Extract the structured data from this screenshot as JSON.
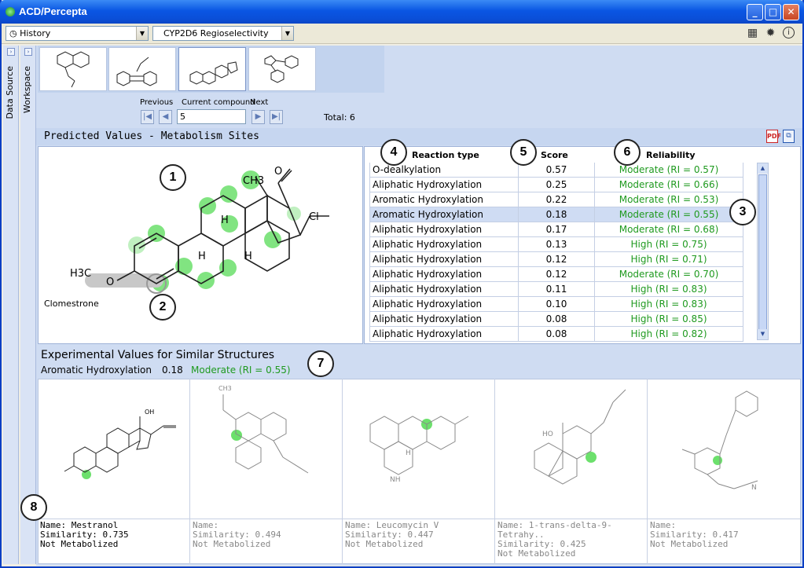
{
  "window": {
    "title": "ACD/Percepta"
  },
  "toolbar": {
    "history_label": "History",
    "module_label": "CYP2D6 Regioselectivity",
    "icons": [
      "calculator-icon",
      "gear-icon",
      "info-icon"
    ]
  },
  "sidebar": {
    "data_source": "Data Source",
    "workspace": "Workspace"
  },
  "navigator": {
    "previous": "Previous",
    "current_label": "Current compound",
    "next": "Next",
    "current_value": "5",
    "total": "Total: 6"
  },
  "predicted": {
    "title": "Predicted Values - Metabolism Sites",
    "structure": {
      "name": "Clomestrone",
      "ch3_top": "CH3",
      "o_top": "O",
      "cl": "Cl",
      "h1": "H",
      "h2": "H",
      "h3": "H",
      "h3c": "H3C",
      "o_left": "O"
    },
    "columns": {
      "reaction": "Reaction type",
      "score": "Score",
      "reliability": "Reliability"
    },
    "rows": [
      {
        "reaction": "O-dealkylation",
        "score": "0.57",
        "reliability": "Moderate (RI = 0.57)"
      },
      {
        "reaction": "Aliphatic Hydroxylation",
        "score": "0.25",
        "reliability": "Moderate (RI = 0.66)"
      },
      {
        "reaction": "Aromatic Hydroxylation",
        "score": "0.22",
        "reliability": "Moderate (RI = 0.53)"
      },
      {
        "reaction": "Aromatic Hydroxylation",
        "score": "0.18",
        "reliability": "Moderate (RI = 0.55)"
      },
      {
        "reaction": "Aliphatic Hydroxylation",
        "score": "0.17",
        "reliability": "Moderate (RI = 0.68)"
      },
      {
        "reaction": "Aliphatic Hydroxylation",
        "score": "0.13",
        "reliability": "High (RI = 0.75)"
      },
      {
        "reaction": "Aliphatic Hydroxylation",
        "score": "0.12",
        "reliability": "High (RI = 0.71)"
      },
      {
        "reaction": "Aliphatic Hydroxylation",
        "score": "0.12",
        "reliability": "Moderate (RI = 0.70)"
      },
      {
        "reaction": "Aliphatic Hydroxylation",
        "score": "0.11",
        "reliability": "High (RI = 0.83)"
      },
      {
        "reaction": "Aliphatic Hydroxylation",
        "score": "0.10",
        "reliability": "High (RI = 0.83)"
      },
      {
        "reaction": "Aliphatic Hydroxylation",
        "score": "0.08",
        "reliability": "High (RI = 0.85)"
      },
      {
        "reaction": "Aliphatic Hydroxylation",
        "score": "0.08",
        "reliability": "High (RI = 0.82)"
      }
    ]
  },
  "experimental": {
    "title": "Experimental Values for Similar Structures",
    "selected_reaction": "Aromatic Hydroxylation",
    "selected_score": "0.18",
    "selected_reliability": "Moderate (RI = 0.55)",
    "cards": [
      {
        "name": "Name: Mestranol",
        "similarity": "Similarity: 0.735",
        "status": "Not Metabolized"
      },
      {
        "name": "Name:",
        "similarity": "Similarity: 0.494",
        "status": "Not Metabolized"
      },
      {
        "name": "Name: Leucomycin V",
        "similarity": "Similarity: 0.447",
        "status": "Not Metabolized"
      },
      {
        "name": "Name: 1-trans-delta-9-Tetrahy..",
        "similarity": "Similarity: 0.425",
        "status": "Not Metabolized"
      },
      {
        "name": "Name:",
        "similarity": "Similarity: 0.417",
        "status": "Not Metabolized"
      }
    ],
    "labels": {
      "oh": "OH",
      "ch3": "CH3",
      "h": "H",
      "nh": "NH",
      "n": "N",
      "ho": "HO"
    }
  },
  "callouts": [
    "1",
    "2",
    "3",
    "4",
    "5",
    "6",
    "7",
    "8"
  ],
  "colors": {
    "accent": "#0a56e3",
    "site_green": "#5ed65e",
    "reliability_text": "#1f9a1f",
    "selected_row": "#cfdcf3"
  }
}
